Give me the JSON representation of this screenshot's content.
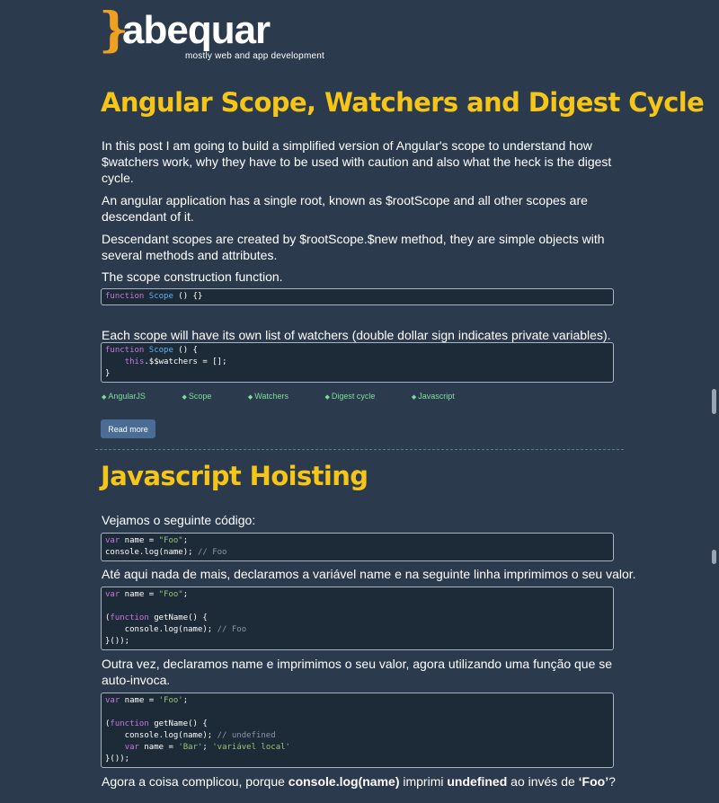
{
  "site": {
    "logo_brace": "}",
    "logo_text": "abequar",
    "tagline": "mostly web and app development"
  },
  "post1": {
    "title": "Angular Scope, Watchers and Digest Cycle",
    "p1": "In this post I am going to build a simplified version of Angular's scope to understand how $watchers work, why they have to be used with caution and also what the heck is the digest cycle.",
    "p2": "An angular application has a single root, known as $rootScope and all other scopes are descendant of it.",
    "p3": "Descendant scopes are created by $rootScope.$new method, they are simple objects with several methods and attributes.",
    "p4": "The scope construction function.",
    "code1": "function Scope () {}",
    "p5": "Each scope will have its own list of watchers (double dollar sign indicates private variables).",
    "code2": "function Scope () {\n    this.$$watchers = [];\n}",
    "tags": [
      "AngularJS",
      "Scope",
      "Watchers",
      "Digest cycle",
      "Javascript"
    ],
    "read_more": "Read more"
  },
  "post2": {
    "title": "Javascript Hoisting",
    "p1": "Vejamos o seguinte código:",
    "code1": "var name = \"Foo\";\nconsole.log(name); // Foo",
    "p2": "Até aqui nada de mais, declaramos a variável name e na seguinte linha imprimimos o seu valor.",
    "code2": "var name = \"Foo\";\n\n(function getName() {\n    console.log(name); // Foo\n}());",
    "p3": "Outra vez, declaramos name e imprimimos o seu valor, agora utilizando uma função que se auto-invoca.",
    "code3": "var name = 'Foo';\n\n(function getName() {\n    console.log(name); // undefined\n    var name = 'Bar'; 'variável local'\n}());",
    "p4_a": "Agora a coisa complicou, porque ",
    "p4_b": "console.log(name)",
    "p4_c": " imprimi ",
    "p4_d": "undefined",
    "p4_e": " ao invés de ",
    "p4_f": "‘Foo’",
    "p4_g": "?"
  },
  "colors": {
    "background": "#2b3a4d",
    "title": "#f5c518",
    "tag": "#7ddf9a",
    "button": "#4a6c95"
  }
}
